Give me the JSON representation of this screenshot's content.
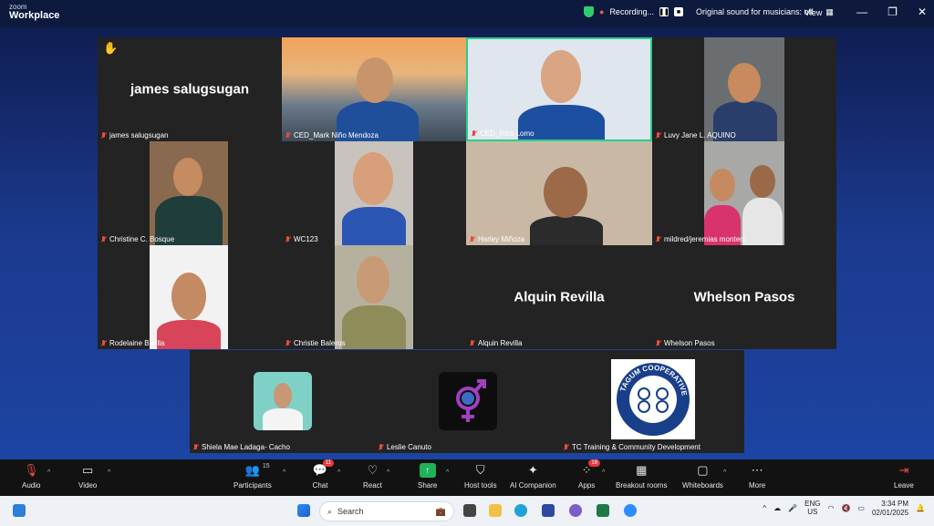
{
  "app": {
    "brand_top": "zoom",
    "brand_bottom": "Workplace"
  },
  "titlebar": {
    "recording_label": "Recording...",
    "original_sound_label": "Original sound for musicians: off",
    "view_label": "View"
  },
  "participants_grid": [
    {
      "name": "james salugsugan",
      "big_name": "james salugsugan"
    },
    {
      "name": "CED_Mark Niño Mendoza"
    },
    {
      "name": "CED_Rica Lomo"
    },
    {
      "name": "Luvy Jane L. AQUINO"
    },
    {
      "name": "Christine C. Bosque"
    },
    {
      "name": "WC123"
    },
    {
      "name": "Harley Miñoza"
    },
    {
      "name": "mildred/jeremias montero"
    },
    {
      "name": "Rodelaine Barilla"
    },
    {
      "name": "Christie Baleros"
    },
    {
      "name": "Alquin Revilla",
      "big_name": "Alquin Revilla"
    },
    {
      "name": "Whelson Pasos",
      "big_name": "Whelson Pasos"
    },
    {
      "name": "Shiela Mae Ladaga- Cacho"
    },
    {
      "name": "Leslie Canuto"
    },
    {
      "name": "TC Training & Community Development"
    }
  ],
  "toolbar": {
    "audio": "Audio",
    "video": "Video",
    "participants": "Participants",
    "participants_count": "15",
    "chat": "Chat",
    "chat_badge": "11",
    "react": "React",
    "share": "Share",
    "host_tools": "Host tools",
    "ai_companion": "AI Companion",
    "apps": "Apps",
    "apps_badge": "18",
    "breakout_rooms": "Breakout rooms",
    "whiteboards": "Whiteboards",
    "more": "More",
    "leave": "Leave"
  },
  "taskbar": {
    "search_label": "Search",
    "lang_top": "ENG",
    "lang_bottom": "US",
    "time": "3:34 PM",
    "date": "02/01/2025"
  },
  "logo_text": {
    "cooperative_seal": "TAGUM COOPERATIVE"
  }
}
